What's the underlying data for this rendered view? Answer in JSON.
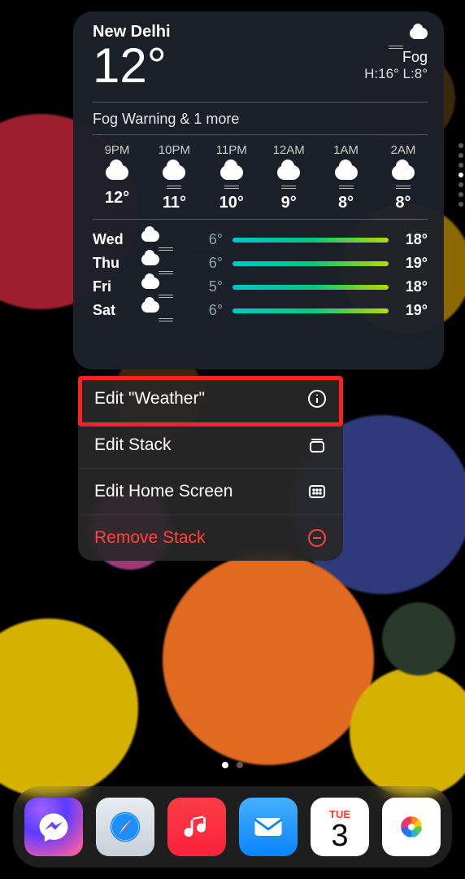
{
  "weather": {
    "location": "New Delhi",
    "current_temp": "12°",
    "condition": "Fog",
    "hi_lo": "H:16° L:8°",
    "warning": "Fog Warning & 1 more",
    "hourly": [
      {
        "time": "9PM",
        "temp": "12°",
        "icon": "cloud"
      },
      {
        "time": "10PM",
        "temp": "11°",
        "icon": "fog"
      },
      {
        "time": "11PM",
        "temp": "10°",
        "icon": "fog"
      },
      {
        "time": "12AM",
        "temp": "9°",
        "icon": "fog"
      },
      {
        "time": "1AM",
        "temp": "8°",
        "icon": "fog"
      },
      {
        "time": "2AM",
        "temp": "8°",
        "icon": "fog"
      }
    ],
    "daily": [
      {
        "day": "Wed",
        "icon": "fog",
        "lo": "6°",
        "hi": "18°"
      },
      {
        "day": "Thu",
        "icon": "fog",
        "lo": "6°",
        "hi": "19°"
      },
      {
        "day": "Fri",
        "icon": "fog",
        "lo": "5°",
        "hi": "18°"
      },
      {
        "day": "Sat",
        "icon": "fog",
        "lo": "6°",
        "hi": "19°"
      }
    ]
  },
  "menu": {
    "edit_widget": "Edit \"Weather\"",
    "edit_stack": "Edit Stack",
    "edit_home": "Edit Home Screen",
    "remove": "Remove Stack"
  },
  "calendar": {
    "weekday": "TUE",
    "day": "3"
  },
  "dock_apps": [
    "messenger",
    "safari",
    "music",
    "mail",
    "calendar",
    "photos"
  ]
}
